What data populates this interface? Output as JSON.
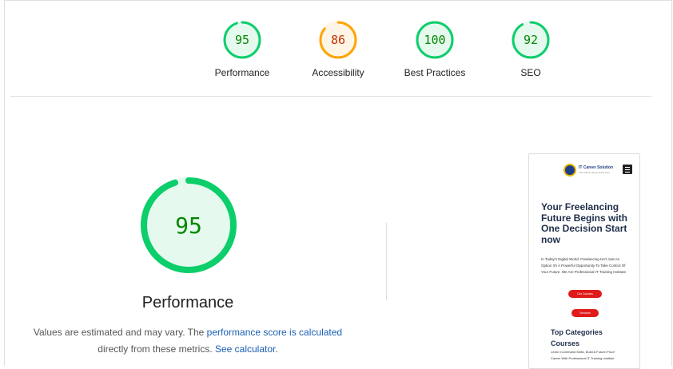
{
  "colors": {
    "pass": "#0cce6b",
    "pass_text": "#008800",
    "average": "#ffa400",
    "average_text": "#c33300"
  },
  "categories": [
    {
      "label": "Performance",
      "score": "95",
      "value": 95,
      "status": "pass"
    },
    {
      "label": "Accessibility",
      "score": "86",
      "value": 86,
      "status": "average"
    },
    {
      "label": "Best Practices",
      "score": "100",
      "value": 100,
      "status": "pass"
    },
    {
      "label": "SEO",
      "score": "92",
      "value": 92,
      "status": "pass"
    }
  ],
  "main": {
    "score": "95",
    "value": 95,
    "title": "Performance",
    "desc_part1": "Values are estimated and may vary. The ",
    "desc_link1": "performance score is calculated",
    "desc_part2": " directly from these metrics. ",
    "desc_link2": "See calculator",
    "desc_part3": "."
  },
  "screenshot": {
    "brand": "IT Career Solution",
    "brand_sub": "Your future career starts here",
    "heading": "Your Freelancing Future Begins with One Decision Start now",
    "paragraph": "In Today's Digital World, Freelancing Isn't Just An Option It's A Powerful Opportunity To Take Control Of Your Future. We Are Professional IT Training Institute",
    "btn1": "Our Courses",
    "btn2": "Services",
    "heading2": "Top Categories Courses",
    "paragraph2": "Learn In-Demand Skills, Build A Future-Proof Career With Professional IT Training Institute"
  }
}
